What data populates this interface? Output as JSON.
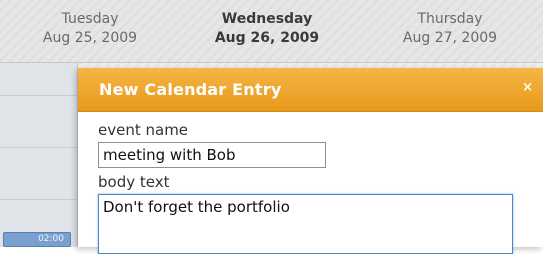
{
  "calendar": {
    "days": [
      {
        "weekday": "Tuesday",
        "date": "Aug 25, 2009"
      },
      {
        "weekday": "Wednesday",
        "date": "Aug 26, 2009"
      },
      {
        "weekday": "Thursday",
        "date": "Aug 27, 2009"
      }
    ],
    "active_day_index": 1,
    "time_slot": "02:00"
  },
  "dialog": {
    "title": "New Calendar Entry",
    "close_glyph": "×",
    "event_name_label": "event name",
    "event_name_value": "meeting with Bob",
    "body_text_label": "body text",
    "body_text_value": "Don't forget the portfolio"
  },
  "colors": {
    "dialog_header": "#f0a830",
    "time_slot": "#7aa0cf"
  }
}
